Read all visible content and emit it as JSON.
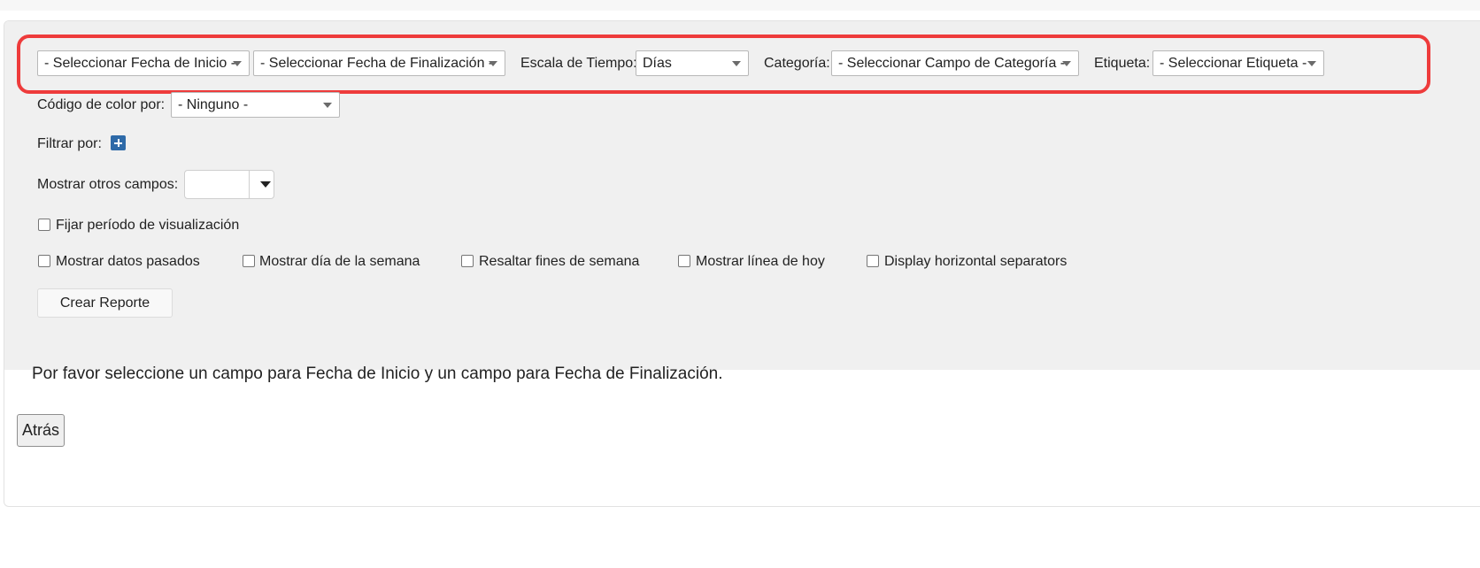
{
  "toolbar": {
    "start_date": "- Seleccionar Fecha de Inicio -",
    "end_date": "- Seleccionar Fecha de Finalización -",
    "time_scale_label": "Escala de Tiempo:",
    "time_scale_value": "Días",
    "category_label": "Categoría:",
    "category_value": "- Seleccionar Campo de Categoría -",
    "tag_label": "Etiqueta:",
    "tag_value": "- Seleccionar Etiqueta -"
  },
  "color_code": {
    "label": "Código de color por:",
    "value": "- Ninguno -"
  },
  "filter": {
    "label": "Filtrar por:",
    "icon": "plus-icon"
  },
  "other_fields": {
    "label": "Mostrar otros campos:"
  },
  "fix_period": {
    "label": "Fijar período de visualización",
    "checked": false
  },
  "options": [
    {
      "label": "Mostrar datos pasados",
      "checked": false
    },
    {
      "label": "Mostrar día de la semana",
      "checked": false
    },
    {
      "label": "Resaltar fines de semana",
      "checked": false
    },
    {
      "label": "Mostrar línea de hoy",
      "checked": false
    },
    {
      "label": "Display horizontal separators",
      "checked": false
    }
  ],
  "create_button": "Crear Reporte",
  "message": "Por favor seleccione un campo para Fecha de Inicio y un campo para Fecha de Finalización.",
  "back_button": "Atrás",
  "colors": {
    "highlight": "#ee3b3b",
    "panel_bg": "#f0f0f0",
    "plus_button": "#2e6aa8"
  }
}
